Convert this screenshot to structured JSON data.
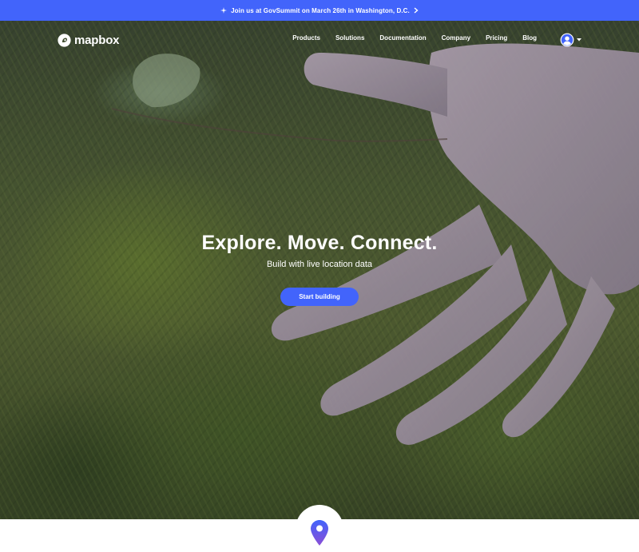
{
  "announcement": {
    "text": "Join us at GovSummit on March 26th in Washington, D.C.",
    "icon": "sparkle-icon",
    "arrow_icon": "chevron-right-icon"
  },
  "brand": {
    "name": "mapbox",
    "accent_color": "#4264fb"
  },
  "nav": {
    "items": [
      {
        "label": "Products"
      },
      {
        "label": "Solutions"
      },
      {
        "label": "Documentation"
      },
      {
        "label": "Company"
      },
      {
        "label": "Pricing"
      },
      {
        "label": "Blog"
      }
    ],
    "user_icon": "user-avatar-icon",
    "dropdown_icon": "caret-down-icon"
  },
  "hero": {
    "title": "Explore. Move. Connect.",
    "subtitle": "Build with live location data",
    "cta_label": "Start building",
    "background": "hand-on-moss-photo"
  },
  "section_marker": {
    "icon": "map-pin-icon"
  }
}
